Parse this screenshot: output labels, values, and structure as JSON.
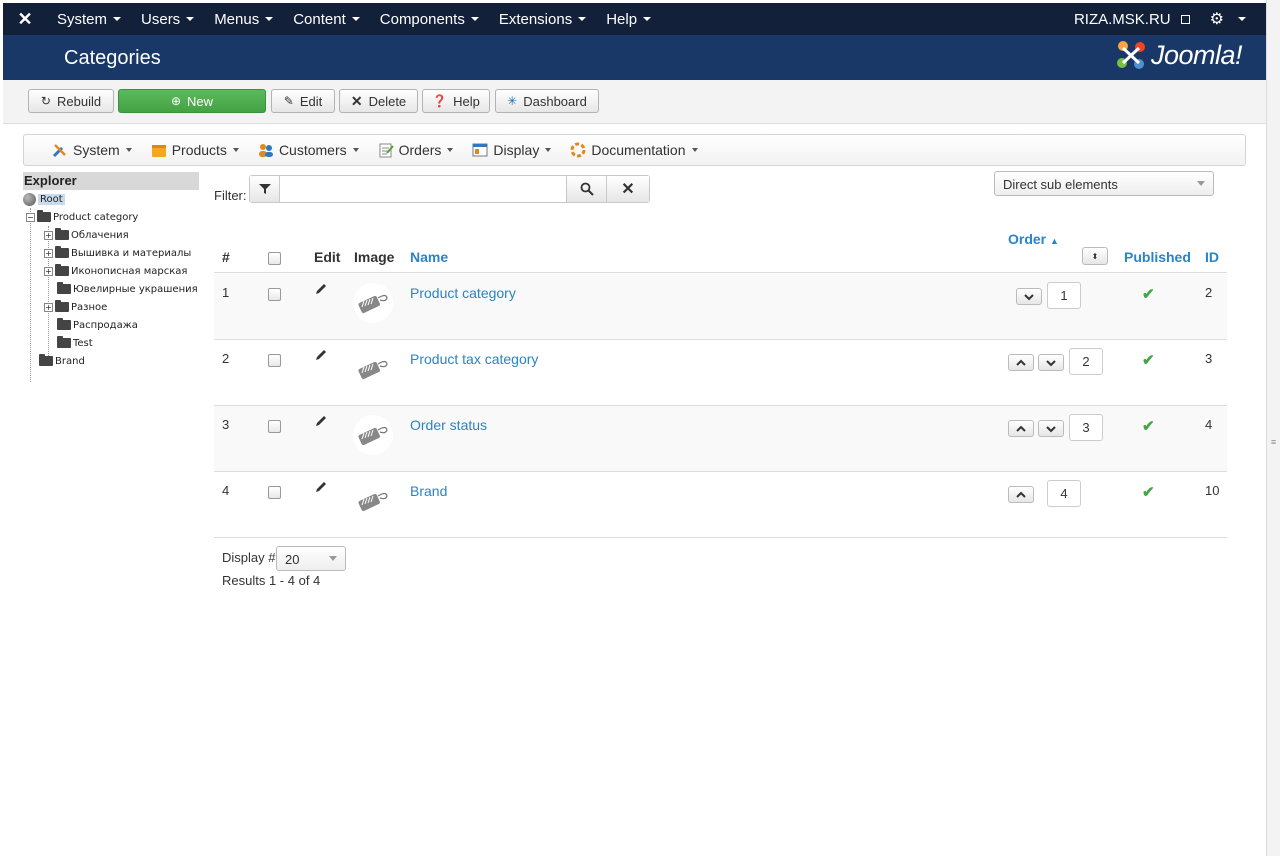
{
  "navbar": {
    "menus": [
      "System",
      "Users",
      "Menus",
      "Content",
      "Components",
      "Extensions",
      "Help"
    ],
    "site_link": "RIZA.MSK.RU"
  },
  "header": {
    "title": "Categories",
    "brand": "Joomla!"
  },
  "toolbar": {
    "rebuild": "Rebuild",
    "new": "New",
    "edit": "Edit",
    "delete": "Delete",
    "help": "Help",
    "dashboard": "Dashboard"
  },
  "submenu": [
    "System",
    "Products",
    "Customers",
    "Orders",
    "Display",
    "Documentation"
  ],
  "explorer": {
    "title": "Explorer",
    "root": "Root",
    "nodes": [
      "Product category",
      "Облачения",
      "Вышивка и материалы",
      "Иконописная марская",
      "Ювелирные украшения",
      "Разное",
      "Распродажа",
      "Test",
      "Brand"
    ]
  },
  "filter": {
    "label": "Filter:",
    "scope": "Direct sub elements"
  },
  "table": {
    "headers": {
      "num": "#",
      "edit": "Edit",
      "image": "Image",
      "name": "Name",
      "order": "Order",
      "published": "Published",
      "id": "ID"
    },
    "rows": [
      {
        "num": "1",
        "name": "Product category",
        "order": "1",
        "id": "2"
      },
      {
        "num": "2",
        "name": "Product tax category",
        "order": "2",
        "id": "3"
      },
      {
        "num": "3",
        "name": "Order status",
        "order": "3",
        "id": "4"
      },
      {
        "num": "4",
        "name": "Brand",
        "order": "4",
        "id": "10"
      }
    ]
  },
  "footer": {
    "display_label": "Display #",
    "limit": "20",
    "results": "Results 1 - 4 of 4"
  },
  "colors": {
    "navbar": "#122039",
    "header": "#1a3867",
    "link": "#2a84c6",
    "new_button": "#4cae4c",
    "published_check": "#46a546"
  }
}
